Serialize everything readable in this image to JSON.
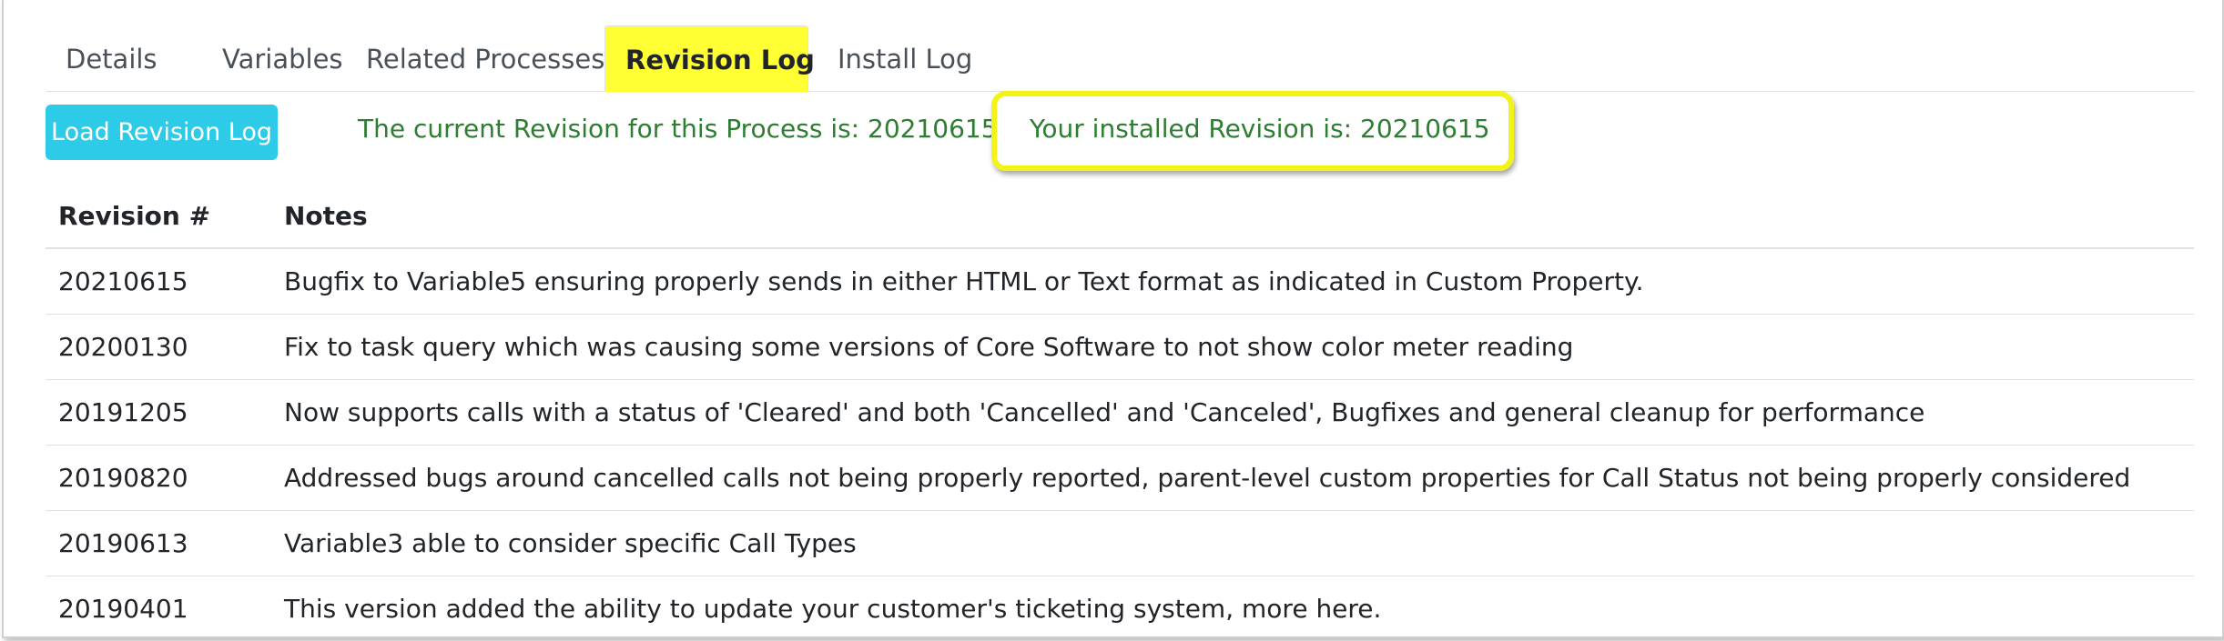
{
  "tabs": [
    {
      "label": "Details",
      "active": false
    },
    {
      "label": "Variables",
      "active": false
    },
    {
      "label": "Related Processes",
      "active": false
    },
    {
      "label": "Revision Log",
      "active": true
    },
    {
      "label": "Install Log",
      "active": false
    }
  ],
  "toolbar": {
    "load_button_label": "Load Revision Log",
    "current_revision_text": "The current Revision for this Process is: 20210615",
    "installed_revision_text": "Your installed Revision is: 20210615"
  },
  "table": {
    "headers": {
      "revision": "Revision #",
      "notes": "Notes"
    },
    "rows": [
      {
        "revision": "20210615",
        "notes": "Bugfix to Variable5 ensuring properly sends in either HTML or Text format as indicated in Custom Property."
      },
      {
        "revision": "20200130",
        "notes": "Fix to task query which was causing some versions of Core Software to not show color meter reading"
      },
      {
        "revision": "20191205",
        "notes": "Now supports calls with a status of 'Cleared' and both 'Cancelled' and 'Canceled', Bugfixes and general cleanup for performance"
      },
      {
        "revision": "20190820",
        "notes": "Addressed bugs around cancelled calls not being properly reported, parent-level custom properties for Call Status not being properly considered"
      },
      {
        "revision": "20190613",
        "notes": "Variable3 able to consider specific Call Types"
      },
      {
        "revision": "20190401",
        "notes": "This version added the ability to update your customer's ticketing system, more here."
      }
    ]
  },
  "colors": {
    "active_tab_highlight": "#ffff33",
    "primary_button": "#2ecbe8",
    "success_text": "#2e7d32",
    "callout_outline": "#f3f31a"
  }
}
